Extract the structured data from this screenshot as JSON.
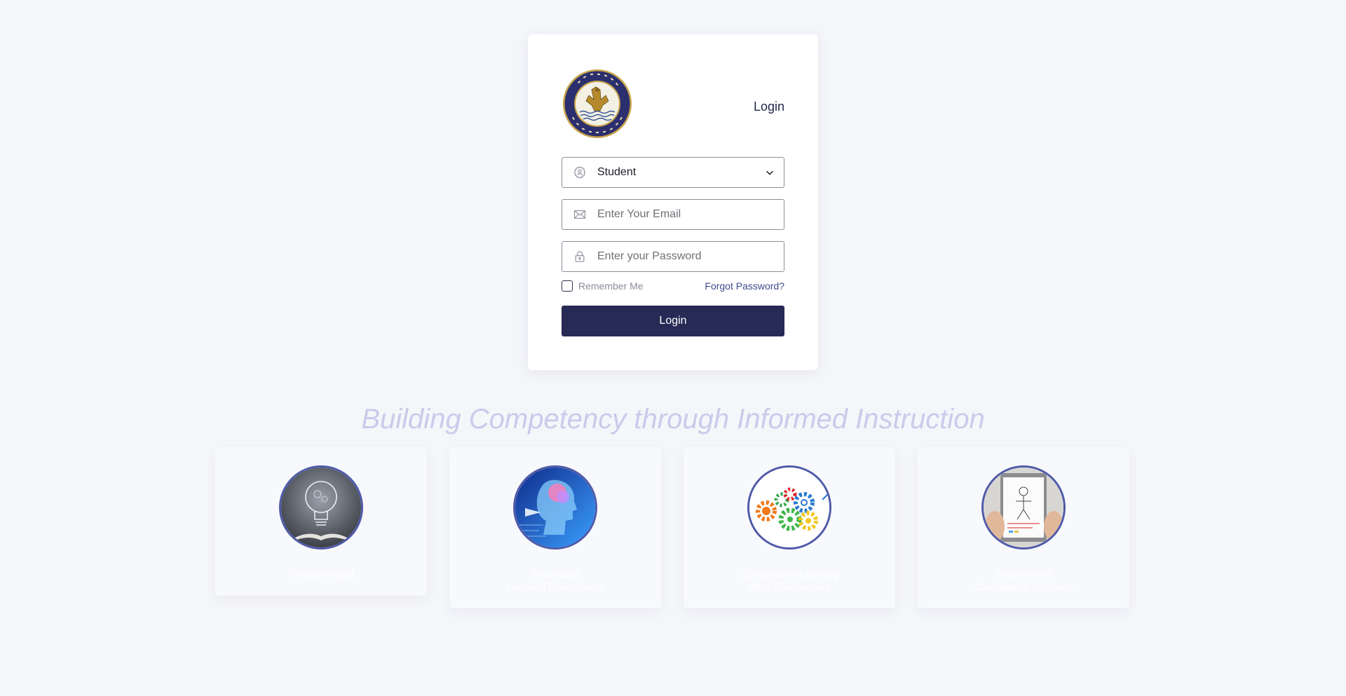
{
  "login": {
    "title": "Login",
    "logo": {
      "name": "qatar-aeronautical-academy-logo",
      "ring_text_top": "أكاديمية قطر لعلوم الطيران",
      "ring_text_bottom": "QATAR AERONAUTICAL ACADEMY"
    },
    "role_select": {
      "value": "Student"
    },
    "email": {
      "placeholder": "Enter Your Email"
    },
    "password": {
      "placeholder": "Enter your Password"
    },
    "remember_label": "Remember Me",
    "forgot_label": "Forgot Password?",
    "submit_label": "Login"
  },
  "tagline": "Building Competency through Informed Instruction",
  "features": [
    {
      "icon": "lightbulb-book-image",
      "label_line1": "Thought Model",
      "label_line2": ""
    },
    {
      "icon": "ai-brain-head-image",
      "label_line1": "Procedural",
      "label_line2": "Learning Environment"
    },
    {
      "icon": "colored-gears-image",
      "label_line1": "Collaborative Learning",
      "label_line2": "Work Environment"
    },
    {
      "icon": "tablet-sketch-image",
      "label_line1": "Teacher and",
      "label_line2": "Competency Solutions"
    }
  ],
  "colors": {
    "background": "#f5f6fa",
    "primary": "#262a55",
    "link": "#3e4a8f",
    "tagline": "#c9cbea",
    "feature_ring": "#4f5aa8"
  }
}
